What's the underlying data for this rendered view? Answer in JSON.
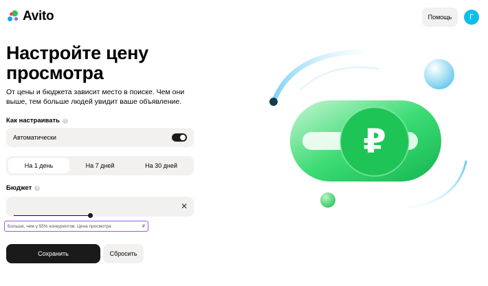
{
  "header": {
    "logo_text": "Avito",
    "help_label": "Помощь",
    "avatar_letter": "Г",
    "avatar_color": "#0ebeea"
  },
  "main": {
    "title": "Настройте цену просмотра",
    "description": "От цены и бюджета зависит место в поиске. Чем они выше, тем больше людей увидит ваше объявление.",
    "how_label": "Как настраивать",
    "auto_label": "Автоматически",
    "auto_enabled": true,
    "periods": [
      "На 1 день",
      "На 7 дней",
      "На 30 дней"
    ],
    "selected_period": "На 1 день",
    "budget_label": "Бюджет",
    "hint_text": "Больше, чем у 55% конкурентов. Цена просмотра",
    "hint_currency": "₽",
    "save_label": "Сохранить",
    "reset_label": "Сбросить"
  },
  "illustration": {
    "coin_symbol": "₽"
  },
  "colors": {
    "accent_green": "#22c55e",
    "dark": "#1a1a1a",
    "panel": "#f2f1f0",
    "hint_border": "#9b59e8"
  }
}
